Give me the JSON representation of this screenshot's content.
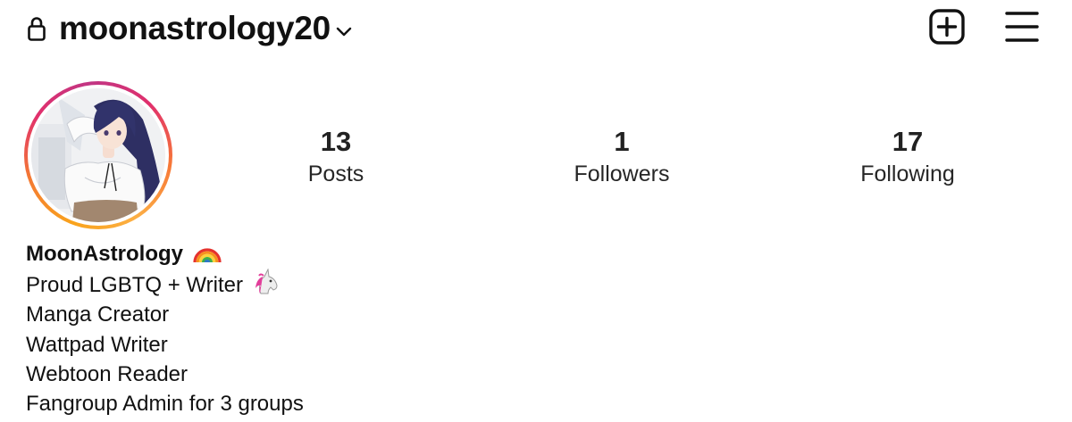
{
  "header": {
    "username": "moonastrology20",
    "lock_icon": "lock-icon",
    "switch_account_icon": "chevron-down-icon",
    "add_icon": "plus-square-icon",
    "menu_icon": "hamburger-menu-icon"
  },
  "profile": {
    "avatar": "profile-picture",
    "story_ring_colors": [
      "#f9a31c",
      "#e1306c",
      "#c13584"
    ]
  },
  "stats": [
    {
      "value": "13",
      "label": "Posts"
    },
    {
      "value": "1",
      "label": "Followers"
    },
    {
      "value": "17",
      "label": "Following"
    }
  ],
  "bio": {
    "name": "MoonAstrology",
    "name_emoji": "rainbow-emoji",
    "lines": [
      "Proud LGBTQ + Writer",
      "Manga Creator",
      "Wattpad Writer",
      "Webtoon Reader",
      "Fangroup Admin for 3 groups"
    ],
    "line1_emoji": "unicorn-emoji"
  }
}
